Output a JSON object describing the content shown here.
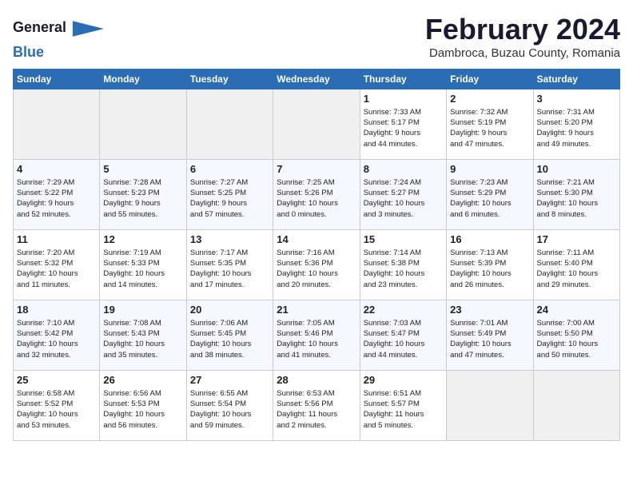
{
  "header": {
    "logo_general": "General",
    "logo_blue": "Blue",
    "month": "February 2024",
    "location": "Dambroca, Buzau County, Romania"
  },
  "days_of_week": [
    "Sunday",
    "Monday",
    "Tuesday",
    "Wednesday",
    "Thursday",
    "Friday",
    "Saturday"
  ],
  "weeks": [
    [
      {
        "day": "",
        "info": ""
      },
      {
        "day": "",
        "info": ""
      },
      {
        "day": "",
        "info": ""
      },
      {
        "day": "",
        "info": ""
      },
      {
        "day": "1",
        "info": "Sunrise: 7:33 AM\nSunset: 5:17 PM\nDaylight: 9 hours\nand 44 minutes."
      },
      {
        "day": "2",
        "info": "Sunrise: 7:32 AM\nSunset: 5:19 PM\nDaylight: 9 hours\nand 47 minutes."
      },
      {
        "day": "3",
        "info": "Sunrise: 7:31 AM\nSunset: 5:20 PM\nDaylight: 9 hours\nand 49 minutes."
      }
    ],
    [
      {
        "day": "4",
        "info": "Sunrise: 7:29 AM\nSunset: 5:22 PM\nDaylight: 9 hours\nand 52 minutes."
      },
      {
        "day": "5",
        "info": "Sunrise: 7:28 AM\nSunset: 5:23 PM\nDaylight: 9 hours\nand 55 minutes."
      },
      {
        "day": "6",
        "info": "Sunrise: 7:27 AM\nSunset: 5:25 PM\nDaylight: 9 hours\nand 57 minutes."
      },
      {
        "day": "7",
        "info": "Sunrise: 7:25 AM\nSunset: 5:26 PM\nDaylight: 10 hours\nand 0 minutes."
      },
      {
        "day": "8",
        "info": "Sunrise: 7:24 AM\nSunset: 5:27 PM\nDaylight: 10 hours\nand 3 minutes."
      },
      {
        "day": "9",
        "info": "Sunrise: 7:23 AM\nSunset: 5:29 PM\nDaylight: 10 hours\nand 6 minutes."
      },
      {
        "day": "10",
        "info": "Sunrise: 7:21 AM\nSunset: 5:30 PM\nDaylight: 10 hours\nand 8 minutes."
      }
    ],
    [
      {
        "day": "11",
        "info": "Sunrise: 7:20 AM\nSunset: 5:32 PM\nDaylight: 10 hours\nand 11 minutes."
      },
      {
        "day": "12",
        "info": "Sunrise: 7:19 AM\nSunset: 5:33 PM\nDaylight: 10 hours\nand 14 minutes."
      },
      {
        "day": "13",
        "info": "Sunrise: 7:17 AM\nSunset: 5:35 PM\nDaylight: 10 hours\nand 17 minutes."
      },
      {
        "day": "14",
        "info": "Sunrise: 7:16 AM\nSunset: 5:36 PM\nDaylight: 10 hours\nand 20 minutes."
      },
      {
        "day": "15",
        "info": "Sunrise: 7:14 AM\nSunset: 5:38 PM\nDaylight: 10 hours\nand 23 minutes."
      },
      {
        "day": "16",
        "info": "Sunrise: 7:13 AM\nSunset: 5:39 PM\nDaylight: 10 hours\nand 26 minutes."
      },
      {
        "day": "17",
        "info": "Sunrise: 7:11 AM\nSunset: 5:40 PM\nDaylight: 10 hours\nand 29 minutes."
      }
    ],
    [
      {
        "day": "18",
        "info": "Sunrise: 7:10 AM\nSunset: 5:42 PM\nDaylight: 10 hours\nand 32 minutes."
      },
      {
        "day": "19",
        "info": "Sunrise: 7:08 AM\nSunset: 5:43 PM\nDaylight: 10 hours\nand 35 minutes."
      },
      {
        "day": "20",
        "info": "Sunrise: 7:06 AM\nSunset: 5:45 PM\nDaylight: 10 hours\nand 38 minutes."
      },
      {
        "day": "21",
        "info": "Sunrise: 7:05 AM\nSunset: 5:46 PM\nDaylight: 10 hours\nand 41 minutes."
      },
      {
        "day": "22",
        "info": "Sunrise: 7:03 AM\nSunset: 5:47 PM\nDaylight: 10 hours\nand 44 minutes."
      },
      {
        "day": "23",
        "info": "Sunrise: 7:01 AM\nSunset: 5:49 PM\nDaylight: 10 hours\nand 47 minutes."
      },
      {
        "day": "24",
        "info": "Sunrise: 7:00 AM\nSunset: 5:50 PM\nDaylight: 10 hours\nand 50 minutes."
      }
    ],
    [
      {
        "day": "25",
        "info": "Sunrise: 6:58 AM\nSunset: 5:52 PM\nDaylight: 10 hours\nand 53 minutes."
      },
      {
        "day": "26",
        "info": "Sunrise: 6:56 AM\nSunset: 5:53 PM\nDaylight: 10 hours\nand 56 minutes."
      },
      {
        "day": "27",
        "info": "Sunrise: 6:55 AM\nSunset: 5:54 PM\nDaylight: 10 hours\nand 59 minutes."
      },
      {
        "day": "28",
        "info": "Sunrise: 6:53 AM\nSunset: 5:56 PM\nDaylight: 11 hours\nand 2 minutes."
      },
      {
        "day": "29",
        "info": "Sunrise: 6:51 AM\nSunset: 5:57 PM\nDaylight: 11 hours\nand 5 minutes."
      },
      {
        "day": "",
        "info": ""
      },
      {
        "day": "",
        "info": ""
      }
    ]
  ]
}
